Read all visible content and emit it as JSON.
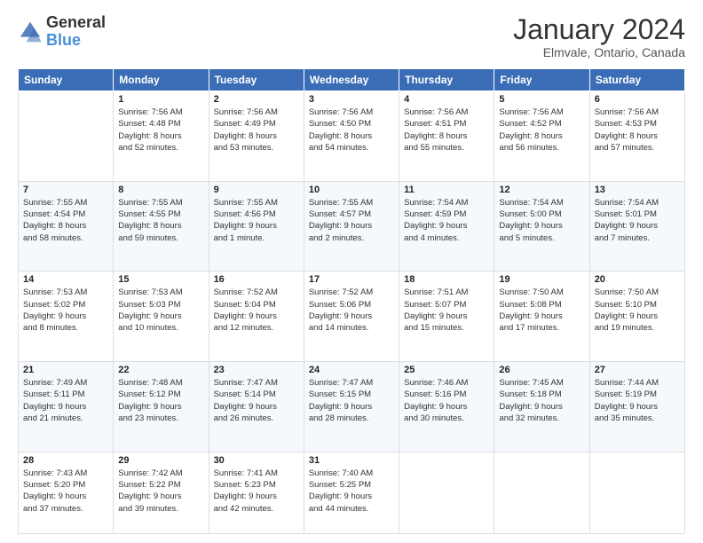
{
  "header": {
    "logo_general": "General",
    "logo_blue": "Blue",
    "month_title": "January 2024",
    "location": "Elmvale, Ontario, Canada"
  },
  "weekdays": [
    "Sunday",
    "Monday",
    "Tuesday",
    "Wednesday",
    "Thursday",
    "Friday",
    "Saturday"
  ],
  "weeks": [
    [
      {
        "day": "",
        "info": ""
      },
      {
        "day": "1",
        "info": "Sunrise: 7:56 AM\nSunset: 4:48 PM\nDaylight: 8 hours\nand 52 minutes."
      },
      {
        "day": "2",
        "info": "Sunrise: 7:56 AM\nSunset: 4:49 PM\nDaylight: 8 hours\nand 53 minutes."
      },
      {
        "day": "3",
        "info": "Sunrise: 7:56 AM\nSunset: 4:50 PM\nDaylight: 8 hours\nand 54 minutes."
      },
      {
        "day": "4",
        "info": "Sunrise: 7:56 AM\nSunset: 4:51 PM\nDaylight: 8 hours\nand 55 minutes."
      },
      {
        "day": "5",
        "info": "Sunrise: 7:56 AM\nSunset: 4:52 PM\nDaylight: 8 hours\nand 56 minutes."
      },
      {
        "day": "6",
        "info": "Sunrise: 7:56 AM\nSunset: 4:53 PM\nDaylight: 8 hours\nand 57 minutes."
      }
    ],
    [
      {
        "day": "7",
        "info": "Sunrise: 7:55 AM\nSunset: 4:54 PM\nDaylight: 8 hours\nand 58 minutes."
      },
      {
        "day": "8",
        "info": "Sunrise: 7:55 AM\nSunset: 4:55 PM\nDaylight: 8 hours\nand 59 minutes."
      },
      {
        "day": "9",
        "info": "Sunrise: 7:55 AM\nSunset: 4:56 PM\nDaylight: 9 hours\nand 1 minute."
      },
      {
        "day": "10",
        "info": "Sunrise: 7:55 AM\nSunset: 4:57 PM\nDaylight: 9 hours\nand 2 minutes."
      },
      {
        "day": "11",
        "info": "Sunrise: 7:54 AM\nSunset: 4:59 PM\nDaylight: 9 hours\nand 4 minutes."
      },
      {
        "day": "12",
        "info": "Sunrise: 7:54 AM\nSunset: 5:00 PM\nDaylight: 9 hours\nand 5 minutes."
      },
      {
        "day": "13",
        "info": "Sunrise: 7:54 AM\nSunset: 5:01 PM\nDaylight: 9 hours\nand 7 minutes."
      }
    ],
    [
      {
        "day": "14",
        "info": "Sunrise: 7:53 AM\nSunset: 5:02 PM\nDaylight: 9 hours\nand 8 minutes."
      },
      {
        "day": "15",
        "info": "Sunrise: 7:53 AM\nSunset: 5:03 PM\nDaylight: 9 hours\nand 10 minutes."
      },
      {
        "day": "16",
        "info": "Sunrise: 7:52 AM\nSunset: 5:04 PM\nDaylight: 9 hours\nand 12 minutes."
      },
      {
        "day": "17",
        "info": "Sunrise: 7:52 AM\nSunset: 5:06 PM\nDaylight: 9 hours\nand 14 minutes."
      },
      {
        "day": "18",
        "info": "Sunrise: 7:51 AM\nSunset: 5:07 PM\nDaylight: 9 hours\nand 15 minutes."
      },
      {
        "day": "19",
        "info": "Sunrise: 7:50 AM\nSunset: 5:08 PM\nDaylight: 9 hours\nand 17 minutes."
      },
      {
        "day": "20",
        "info": "Sunrise: 7:50 AM\nSunset: 5:10 PM\nDaylight: 9 hours\nand 19 minutes."
      }
    ],
    [
      {
        "day": "21",
        "info": "Sunrise: 7:49 AM\nSunset: 5:11 PM\nDaylight: 9 hours\nand 21 minutes."
      },
      {
        "day": "22",
        "info": "Sunrise: 7:48 AM\nSunset: 5:12 PM\nDaylight: 9 hours\nand 23 minutes."
      },
      {
        "day": "23",
        "info": "Sunrise: 7:47 AM\nSunset: 5:14 PM\nDaylight: 9 hours\nand 26 minutes."
      },
      {
        "day": "24",
        "info": "Sunrise: 7:47 AM\nSunset: 5:15 PM\nDaylight: 9 hours\nand 28 minutes."
      },
      {
        "day": "25",
        "info": "Sunrise: 7:46 AM\nSunset: 5:16 PM\nDaylight: 9 hours\nand 30 minutes."
      },
      {
        "day": "26",
        "info": "Sunrise: 7:45 AM\nSunset: 5:18 PM\nDaylight: 9 hours\nand 32 minutes."
      },
      {
        "day": "27",
        "info": "Sunrise: 7:44 AM\nSunset: 5:19 PM\nDaylight: 9 hours\nand 35 minutes."
      }
    ],
    [
      {
        "day": "28",
        "info": "Sunrise: 7:43 AM\nSunset: 5:20 PM\nDaylight: 9 hours\nand 37 minutes."
      },
      {
        "day": "29",
        "info": "Sunrise: 7:42 AM\nSunset: 5:22 PM\nDaylight: 9 hours\nand 39 minutes."
      },
      {
        "day": "30",
        "info": "Sunrise: 7:41 AM\nSunset: 5:23 PM\nDaylight: 9 hours\nand 42 minutes."
      },
      {
        "day": "31",
        "info": "Sunrise: 7:40 AM\nSunset: 5:25 PM\nDaylight: 9 hours\nand 44 minutes."
      },
      {
        "day": "",
        "info": ""
      },
      {
        "day": "",
        "info": ""
      },
      {
        "day": "",
        "info": ""
      }
    ]
  ]
}
